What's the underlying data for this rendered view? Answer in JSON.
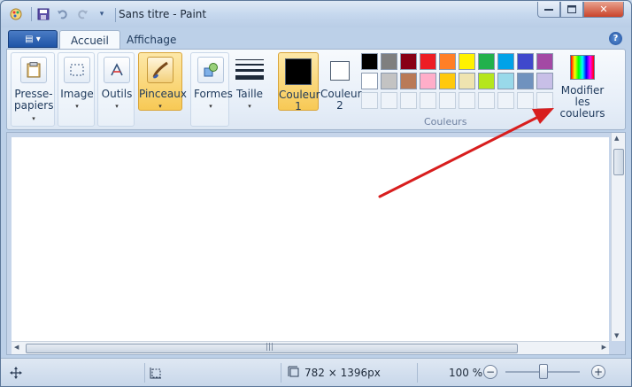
{
  "window": {
    "title": "Sans titre - Paint"
  },
  "tabs": [
    {
      "label": "Accueil",
      "active": true
    },
    {
      "label": "Affichage",
      "active": false
    }
  ],
  "ribbon": {
    "presse_papiers": "Presse-papiers",
    "presse_line1": "Presse-",
    "presse_line2": "papiers",
    "image": "Image",
    "outils": "Outils",
    "pinceaux": "Pinceaux",
    "formes": "Formes",
    "taille": "Taille",
    "couleur1_line1": "Couleur",
    "couleur1_line2": "1",
    "couleur2_line1": "Couleur",
    "couleur2_line2": "2",
    "couleurs_group": "Couleurs",
    "modifier_line1": "Modifier les",
    "modifier_line2": "couleurs"
  },
  "palette": {
    "row1": [
      "#000000",
      "#7f7f7f",
      "#880015",
      "#ed1c24",
      "#ff7f27",
      "#fff200",
      "#22b14c",
      "#00a2e8",
      "#3f48cc",
      "#a349a4"
    ],
    "row2": [
      "#ffffff",
      "#c3c3c3",
      "#b97a57",
      "#ffaec9",
      "#ffc90e",
      "#efe4b0",
      "#b5e61d",
      "#99d9ea",
      "#7092be",
      "#c8bfe7"
    ],
    "row3_empty_count": 10
  },
  "colors": {
    "couleur1": "#000000",
    "couleur2": "#ffffff",
    "annotation_arrow": "#d81e1e"
  },
  "status": {
    "dimensions": "782 × 1396px",
    "zoom": "100 %"
  },
  "icons": {
    "app_menu": "app-menu-icon",
    "save": "save-icon",
    "undo": "undo-icon",
    "redo": "redo-icon",
    "help": "help-icon"
  }
}
